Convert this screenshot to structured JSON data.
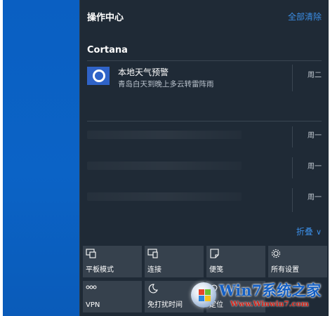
{
  "action_center": {
    "title": "操作中心",
    "clear_all": "全部清除",
    "collapse_label": "折叠"
  },
  "groups": [
    {
      "name": "Cortana",
      "notification": {
        "title": "本地天气预警",
        "body": "青岛白天到晚上多云转雷阵雨",
        "day": "周二",
        "icon": "cortana-ring-icon"
      }
    }
  ],
  "faint_rows": [
    {
      "day": "周一"
    },
    {
      "day": "周一"
    },
    {
      "day": "周一"
    }
  ],
  "quick_actions": [
    {
      "label": "平板模式",
      "icon": "tablet-mode-icon"
    },
    {
      "label": "连接",
      "icon": "connect-icon"
    },
    {
      "label": "便笺",
      "icon": "note-icon"
    },
    {
      "label": "所有设置",
      "icon": "gear-icon"
    },
    {
      "label": "VPN",
      "icon": "vpn-icon"
    },
    {
      "label": "免打扰时间",
      "icon": "moon-icon"
    },
    {
      "label": "定位",
      "icon": "location-icon"
    }
  ],
  "watermark": {
    "text": "Win7系统之家",
    "url": "Www.Winwin7.com"
  },
  "colors": {
    "panel_bg": "#1f2a36",
    "tile_bg": "#36414d",
    "accent": "#3b8ee6",
    "desktop_blue": "#0b63c6"
  }
}
